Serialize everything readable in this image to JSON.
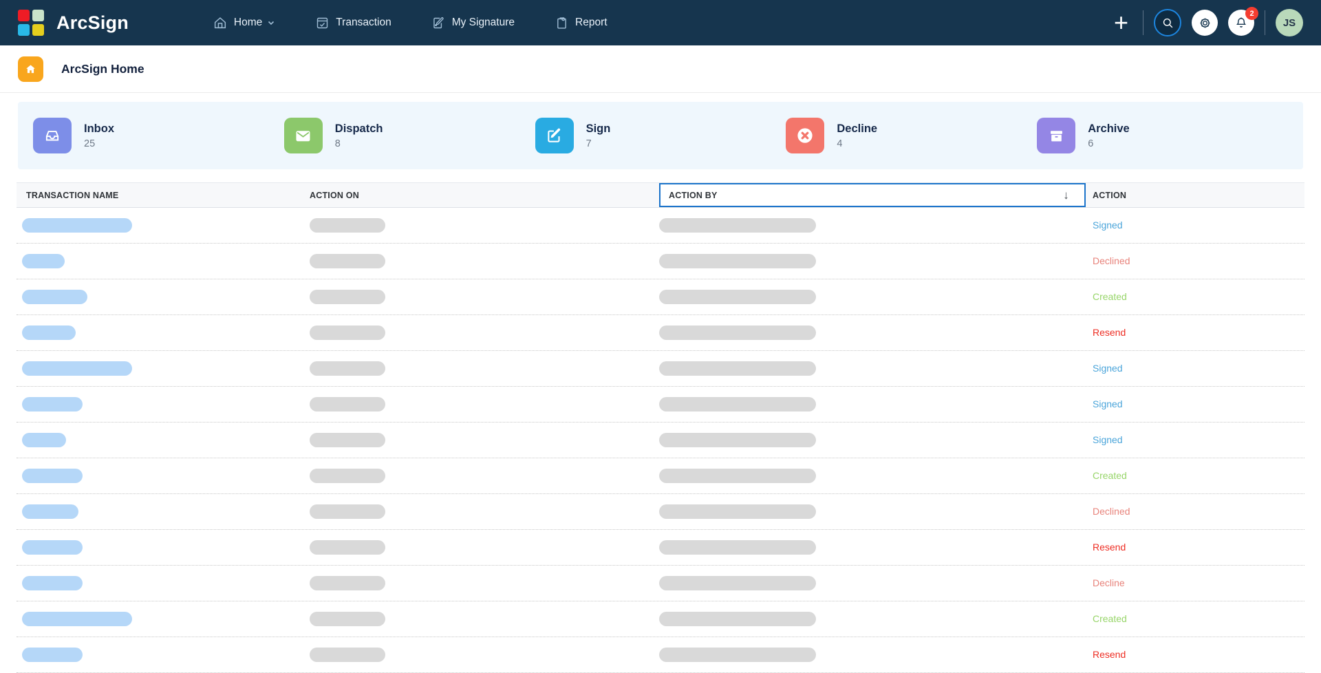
{
  "brand": {
    "name": "ArcSign",
    "logo_colors": [
      "#ee1c25",
      "#c9e4ca",
      "#29b9e8",
      "#e5cf1e"
    ]
  },
  "nav": {
    "items": [
      {
        "label": "Home",
        "icon": "home-icon",
        "has_dropdown": true
      },
      {
        "label": "Transaction",
        "icon": "transaction-icon"
      },
      {
        "label": "My Signature",
        "icon": "signature-icon"
      },
      {
        "label": "Report",
        "icon": "report-icon"
      }
    ],
    "notification_count": "2",
    "avatar_initials": "JS",
    "accent_ring": "#1d86e0",
    "badge_color": "#f53d30"
  },
  "breadcrumb": {
    "title": "ArcSign Home",
    "badge_color": "#f9a61d"
  },
  "stats": [
    {
      "label": "Inbox",
      "count": "25",
      "color": "#7d8ee8",
      "icon": "inbox-icon"
    },
    {
      "label": "Dispatch",
      "count": "8",
      "color": "#8cc86b",
      "icon": "envelope-icon"
    },
    {
      "label": "Sign",
      "count": "7",
      "color": "#29abe2",
      "icon": "edit-icon"
    },
    {
      "label": "Decline",
      "count": "4",
      "color": "#f3766b",
      "icon": "x-circle-icon"
    },
    {
      "label": "Archive",
      "count": "6",
      "color": "#9486e5",
      "icon": "archive-icon"
    }
  ],
  "table": {
    "headers": {
      "name": "TRANSACTION NAME",
      "action_on": "ACTION ON",
      "action_by": "ACTION BY",
      "action": "ACTION"
    },
    "sort": {
      "column": "ACTION BY",
      "direction": "down",
      "arrow": "↓",
      "border_color": "#1a73ca"
    },
    "action_colors": {
      "signed": "#4ba5da",
      "declined": "#e8837b",
      "created": "#97d569",
      "resend": "#ee2e24",
      "decline": "#e8837b"
    },
    "rows": [
      {
        "action": "Signed",
        "type": "signed",
        "name_w": 160
      },
      {
        "action": "Declined",
        "type": "declined",
        "name_w": 62
      },
      {
        "action": "Created",
        "type": "created",
        "name_w": 95
      },
      {
        "action": "Resend",
        "type": "resend",
        "name_w": 78
      },
      {
        "action": "Signed",
        "type": "signed",
        "name_w": 160
      },
      {
        "action": "Signed",
        "type": "signed",
        "name_w": 88
      },
      {
        "action": "Signed",
        "type": "signed",
        "name_w": 64
      },
      {
        "action": "Created",
        "type": "created",
        "name_w": 88
      },
      {
        "action": "Declined",
        "type": "declined",
        "name_w": 82
      },
      {
        "action": "Resend",
        "type": "resend",
        "name_w": 88
      },
      {
        "action": "Decline",
        "type": "decline",
        "name_w": 88
      },
      {
        "action": "Created",
        "type": "created",
        "name_w": 160
      },
      {
        "action": "Resend",
        "type": "resend",
        "name_w": 88
      }
    ]
  }
}
